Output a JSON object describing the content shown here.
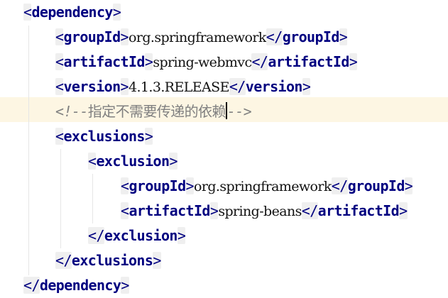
{
  "editor": {
    "lines": {
      "dependency_open": {
        "name": "dependency"
      },
      "groupId": {
        "name": "groupId",
        "value": "org.springframework"
      },
      "artifactId": {
        "name": "artifactId",
        "value": "spring-webmvc"
      },
      "version": {
        "name": "version",
        "value": "4.1.3.RELEASE"
      },
      "comment": {
        "open": "<!--",
        "text": "指定不需要传递的依赖",
        "close": "-->"
      },
      "exclusions_open": {
        "name": "exclusions"
      },
      "exclusion_open": {
        "name": "exclusion"
      },
      "ex_groupId": {
        "name": "groupId",
        "value": "org.springframework"
      },
      "ex_artifactId": {
        "name": "artifactId",
        "value": "spring-beans"
      },
      "exclusion_close": {
        "name": "exclusion"
      },
      "exclusions_close": {
        "name": "exclusions"
      },
      "dependency_close": {
        "name": "dependency"
      }
    },
    "punct": {
      "lt": "<",
      "gt": ">",
      "lt_slash": "</"
    },
    "colors": {
      "background": "#ffffff",
      "tag": "#000080",
      "tag_background": "#efefef",
      "text": "#111111",
      "comment": "#808080",
      "current_line": "#fdf6e3"
    }
  }
}
